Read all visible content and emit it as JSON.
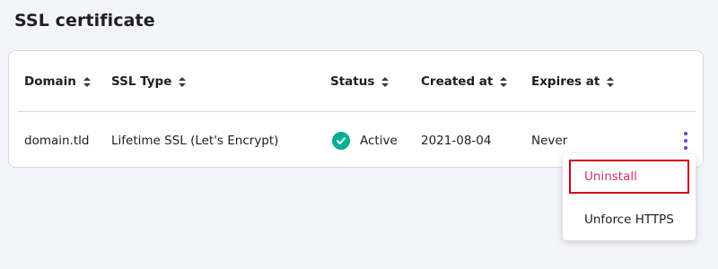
{
  "page": {
    "title": "SSL certificate"
  },
  "table": {
    "columns": [
      "Domain",
      "SSL Type",
      "Status",
      "Created at",
      "Expires at"
    ],
    "rows": [
      {
        "domain": "domain.tld",
        "ssl_type": "Lifetime SSL (Let's Encrypt)",
        "status": "Active",
        "created_at": "2021-08-04",
        "expires_at": "Never"
      }
    ]
  },
  "menu": {
    "items": [
      "Uninstall",
      "Unforce HTTPS"
    ]
  },
  "icons": {
    "sort": "sort-icon",
    "status": "check-circle-icon",
    "more": "kebab-menu-icon"
  },
  "colors": {
    "accent": "#673de6",
    "status_active": "#00b090",
    "danger": "#d63163",
    "highlight_border": "#d0021b"
  }
}
